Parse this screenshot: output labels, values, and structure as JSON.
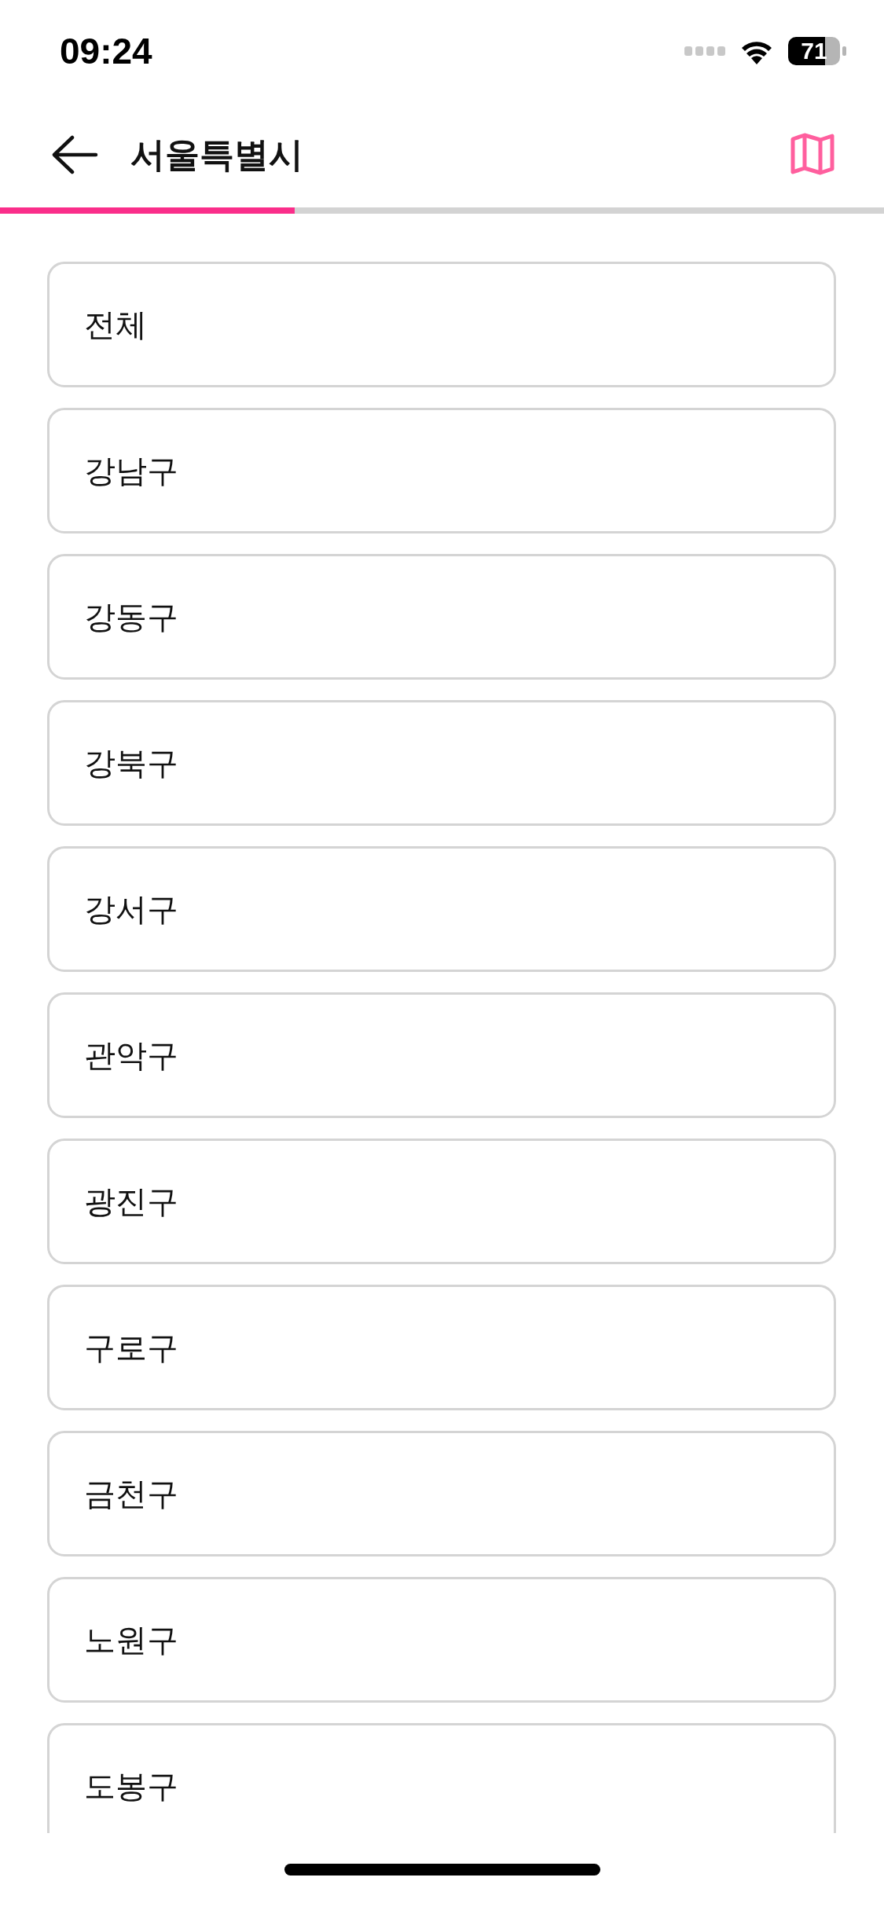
{
  "status_bar": {
    "time": "09:24",
    "battery": "71"
  },
  "header": {
    "title": "서울특별시"
  },
  "progress": {
    "level": 0.333
  },
  "districts": [
    {
      "name": "전체"
    },
    {
      "name": "강남구"
    },
    {
      "name": "강동구"
    },
    {
      "name": "강북구"
    },
    {
      "name": "강서구"
    },
    {
      "name": "관악구"
    },
    {
      "name": "광진구"
    },
    {
      "name": "구로구"
    },
    {
      "name": "금천구"
    },
    {
      "name": "노원구"
    },
    {
      "name": "도봉구"
    }
  ]
}
